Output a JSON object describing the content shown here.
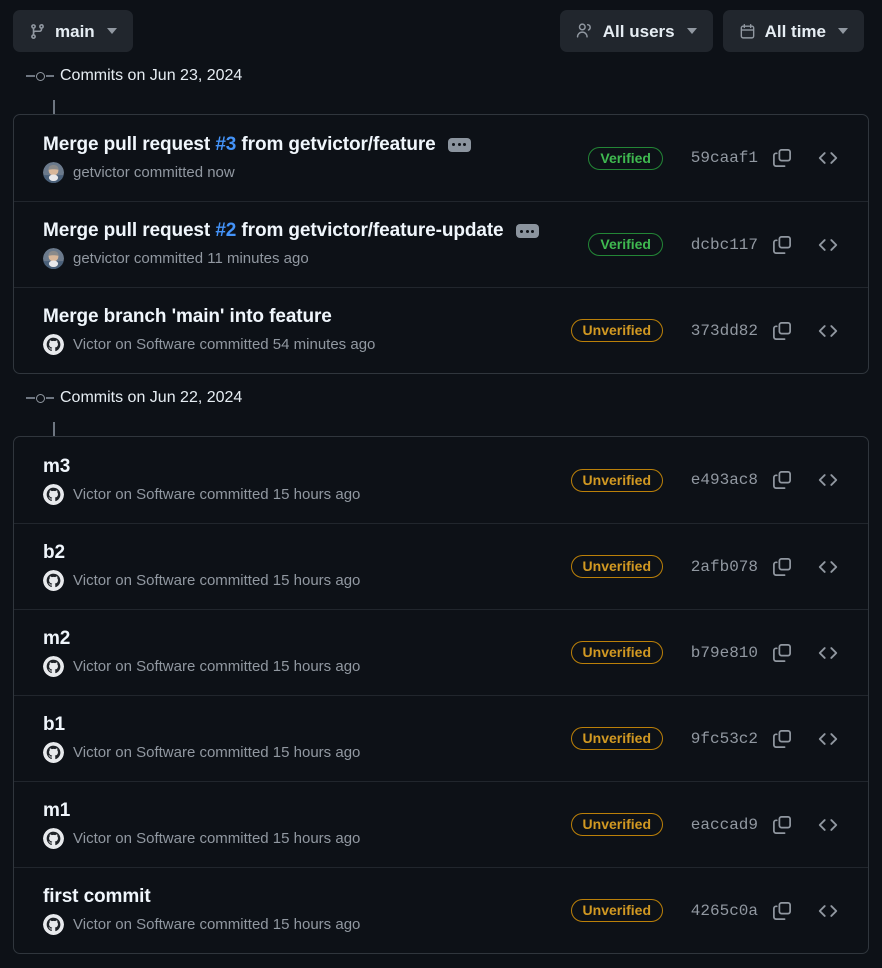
{
  "toolbar": {
    "branch_button": {
      "label": "main",
      "icon": "git-branch-icon"
    },
    "users_filter": {
      "label": "All users",
      "icon": "people-icon"
    },
    "time_filter": {
      "label": "All time",
      "icon": "calendar-icon"
    }
  },
  "row_actions": {
    "copy_label": "copy-sha-icon",
    "code_label": "browse-code-icon",
    "expand_label": "expand-commit-message"
  },
  "sections": [
    {
      "date_heading": "Commits on Jun 23, 2024",
      "commits": [
        {
          "title_prefix": "Merge pull request ",
          "title_link": "#3",
          "title_suffix": " from getvictor/feature",
          "has_expand": true,
          "author": "getvictor",
          "meta": "getvictor committed now",
          "avatar": "photo-avatar",
          "verification": "Verified",
          "verification_state": "verified",
          "sha": "59caaf1"
        },
        {
          "title_prefix": "Merge pull request ",
          "title_link": "#2",
          "title_suffix": " from getvictor/feature-update",
          "has_expand": true,
          "author": "getvictor",
          "meta": "getvictor committed 11 minutes ago",
          "avatar": "photo-avatar",
          "verification": "Verified",
          "verification_state": "verified",
          "sha": "dcbc117"
        },
        {
          "title_prefix": "Merge branch 'main' into feature",
          "title_link": "",
          "title_suffix": "",
          "has_expand": false,
          "author": "Victor on Software",
          "meta": "Victor on Software committed 54 minutes ago",
          "avatar": "github-avatar",
          "verification": "Unverified",
          "verification_state": "unverified",
          "sha": "373dd82"
        }
      ]
    },
    {
      "date_heading": "Commits on Jun 22, 2024",
      "commits": [
        {
          "title_prefix": "m3",
          "title_link": "",
          "title_suffix": "",
          "has_expand": false,
          "author": "Victor on Software",
          "meta": "Victor on Software committed 15 hours ago",
          "avatar": "github-avatar",
          "verification": "Unverified",
          "verification_state": "unverified",
          "sha": "e493ac8"
        },
        {
          "title_prefix": "b2",
          "title_link": "",
          "title_suffix": "",
          "has_expand": false,
          "author": "Victor on Software",
          "meta": "Victor on Software committed 15 hours ago",
          "avatar": "github-avatar",
          "verification": "Unverified",
          "verification_state": "unverified",
          "sha": "2afb078"
        },
        {
          "title_prefix": "m2",
          "title_link": "",
          "title_suffix": "",
          "has_expand": false,
          "author": "Victor on Software",
          "meta": "Victor on Software committed 15 hours ago",
          "avatar": "github-avatar",
          "verification": "Unverified",
          "verification_state": "unverified",
          "sha": "b79e810"
        },
        {
          "title_prefix": "b1",
          "title_link": "",
          "title_suffix": "",
          "has_expand": false,
          "author": "Victor on Software",
          "meta": "Victor on Software committed 15 hours ago",
          "avatar": "github-avatar",
          "verification": "Unverified",
          "verification_state": "unverified",
          "sha": "9fc53c2"
        },
        {
          "title_prefix": "m1",
          "title_link": "",
          "title_suffix": "",
          "has_expand": false,
          "author": "Victor on Software",
          "meta": "Victor on Software committed 15 hours ago",
          "avatar": "github-avatar",
          "verification": "Unverified",
          "verification_state": "unverified",
          "sha": "eaccad9"
        },
        {
          "title_prefix": "first commit",
          "title_link": "",
          "title_suffix": "",
          "has_expand": false,
          "author": "Victor on Software",
          "meta": "Victor on Software committed 15 hours ago",
          "avatar": "github-avatar",
          "verification": "Unverified",
          "verification_state": "unverified",
          "sha": "4265c0a"
        }
      ]
    }
  ],
  "colors": {
    "background": "#0d1117",
    "border": "#30363d",
    "verified": "#3fb950",
    "unverified": "#d29922",
    "link": "#4493f8",
    "muted": "#9198a1"
  }
}
